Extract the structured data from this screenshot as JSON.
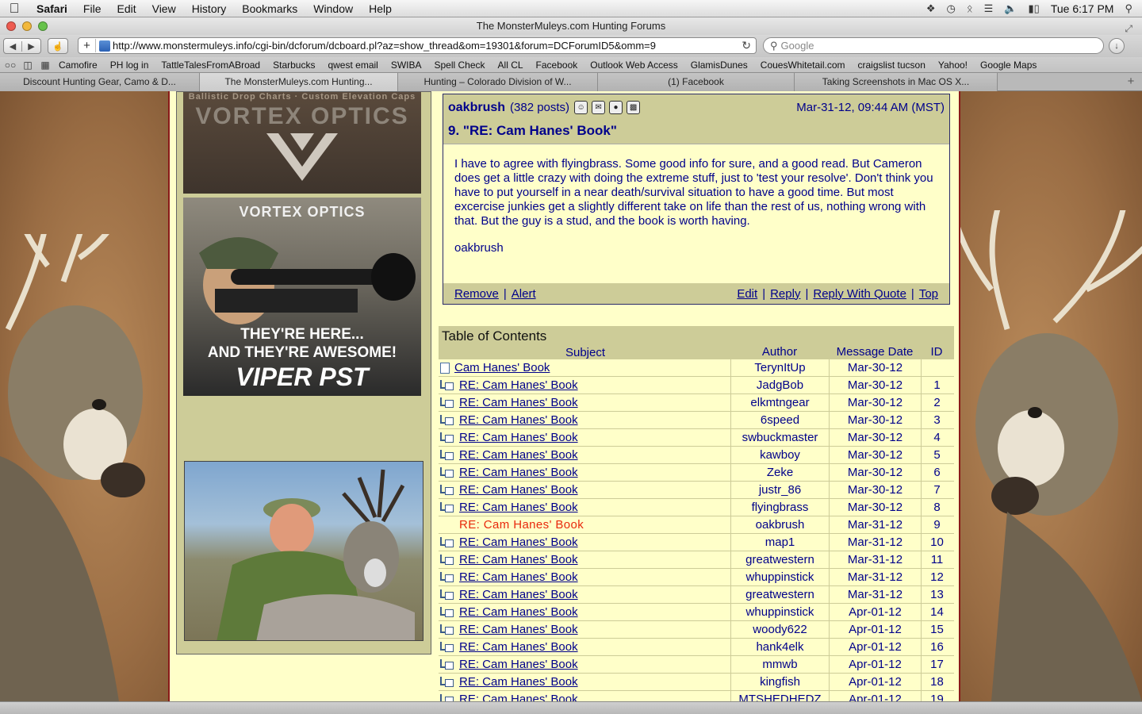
{
  "menubar": {
    "app": "Safari",
    "items": [
      "File",
      "Edit",
      "View",
      "History",
      "Bookmarks",
      "Window",
      "Help"
    ],
    "clock": "Tue 6:17 PM"
  },
  "window": {
    "title": "The MonsterMuleys.com Hunting Forums"
  },
  "toolbar": {
    "url": "http://www.monstermuleys.info/cgi-bin/dcforum/dcboard.pl?az=show_thread&om=19301&forum=DCForumID5&omm=9",
    "search_placeholder": "Google"
  },
  "bookmarks": [
    "Camofire",
    "PH log in",
    "TattleTalesFromABroad",
    "Starbucks",
    "qwest email",
    "SWIBA",
    "Spell Check",
    "All CL",
    "Facebook",
    "Outlook Web Access",
    "GlamisDunes",
    "CouesWhitetail.com",
    "craigslist tucson",
    "Yahoo!",
    "Google Maps"
  ],
  "tabs": [
    {
      "label": "Discount Hunting Gear, Camo & D..."
    },
    {
      "label": "The MonsterMuleys.com Hunting..."
    },
    {
      "label": "Hunting – Colorado Division of W..."
    },
    {
      "label": "(1) Facebook"
    },
    {
      "label": "Taking Screenshots in Mac OS X..."
    }
  ],
  "ads": {
    "ad1_top": "Ballistic Drop Charts · Custom Elevation Caps",
    "ad1_brand": "VORTEX OPTICS",
    "ad2_brand": "VORTEX OPTICS",
    "ad2_line1": "THEY'RE HERE...",
    "ad2_line2": "AND THEY'RE AWESOME!",
    "ad2_product": "VIPER PST"
  },
  "post": {
    "author": "oakbrush",
    "post_count": "(382 posts)",
    "date": "Mar-31-12, 09:44 AM (MST)",
    "title": "9. \"RE: Cam Hanes' Book\"",
    "body": "I have to agree with flyingbrass. Some good info for sure, and a good read. But Cameron does get a little crazy with doing the extreme stuff, just to 'test your resolve'. Don't think you have to put yourself in a near death/survival situation to have a good time. But most excercise junkies get a slightly different take on life than the rest of us, nothing wrong with that. But the guy is a stud, and the book is worth having.",
    "signature": "oakbrush",
    "actions_left": [
      "Remove",
      "Alert"
    ],
    "actions_right": [
      "Edit",
      "Reply",
      "Reply With Quote",
      "Top"
    ]
  },
  "toc": {
    "title": "Table of Contents",
    "headers": {
      "subject": "Subject",
      "author": "Author",
      "date": "Message Date",
      "id": "ID"
    },
    "rows": [
      {
        "subject": "Cam Hanes' Book",
        "author": "TerynItUp",
        "date": "Mar-30-12",
        "id": "",
        "type": "root"
      },
      {
        "subject": "RE: Cam Hanes' Book",
        "author": "JadgBob",
        "date": "Mar-30-12",
        "id": "1",
        "type": "reply"
      },
      {
        "subject": "RE: Cam Hanes' Book",
        "author": "elkmtngear",
        "date": "Mar-30-12",
        "id": "2",
        "type": "reply"
      },
      {
        "subject": "RE: Cam Hanes' Book",
        "author": "6speed",
        "date": "Mar-30-12",
        "id": "3",
        "type": "reply"
      },
      {
        "subject": "RE: Cam Hanes' Book",
        "author": "swbuckmaster",
        "date": "Mar-30-12",
        "id": "4",
        "type": "reply"
      },
      {
        "subject": "RE: Cam Hanes' Book",
        "author": "kawboy",
        "date": "Mar-30-12",
        "id": "5",
        "type": "reply"
      },
      {
        "subject": "RE: Cam Hanes' Book",
        "author": "Zeke",
        "date": "Mar-30-12",
        "id": "6",
        "type": "reply"
      },
      {
        "subject": "RE: Cam Hanes' Book",
        "author": "justr_86",
        "date": "Mar-30-12",
        "id": "7",
        "type": "reply"
      },
      {
        "subject": "RE: Cam Hanes' Book",
        "author": "flyingbrass",
        "date": "Mar-30-12",
        "id": "8",
        "type": "reply"
      },
      {
        "subject": "RE: Cam Hanes' Book",
        "author": "oakbrush",
        "date": "Mar-31-12",
        "id": "9",
        "type": "current"
      },
      {
        "subject": "RE: Cam Hanes' Book",
        "author": "map1",
        "date": "Mar-31-12",
        "id": "10",
        "type": "reply"
      },
      {
        "subject": "RE: Cam Hanes' Book",
        "author": "greatwestern",
        "date": "Mar-31-12",
        "id": "11",
        "type": "reply"
      },
      {
        "subject": "RE: Cam Hanes' Book",
        "author": "whuppinstick",
        "date": "Mar-31-12",
        "id": "12",
        "type": "reply"
      },
      {
        "subject": "RE: Cam Hanes' Book",
        "author": "greatwestern",
        "date": "Mar-31-12",
        "id": "13",
        "type": "reply"
      },
      {
        "subject": "RE: Cam Hanes' Book",
        "author": "whuppinstick",
        "date": "Apr-01-12",
        "id": "14",
        "type": "reply"
      },
      {
        "subject": "RE: Cam Hanes' Book",
        "author": "woody622",
        "date": "Apr-01-12",
        "id": "15",
        "type": "reply"
      },
      {
        "subject": "RE: Cam Hanes' Book",
        "author": "hank4elk",
        "date": "Apr-01-12",
        "id": "16",
        "type": "reply"
      },
      {
        "subject": "RE: Cam Hanes' Book",
        "author": "mmwb",
        "date": "Apr-01-12",
        "id": "17",
        "type": "reply"
      },
      {
        "subject": "RE: Cam Hanes' Book",
        "author": "kingfish",
        "date": "Apr-01-12",
        "id": "18",
        "type": "reply"
      },
      {
        "subject": "RE: Cam Hanes' Book",
        "author": "MTSHEDHEDZ",
        "date": "Apr-01-12",
        "id": "19",
        "type": "reply"
      }
    ]
  }
}
